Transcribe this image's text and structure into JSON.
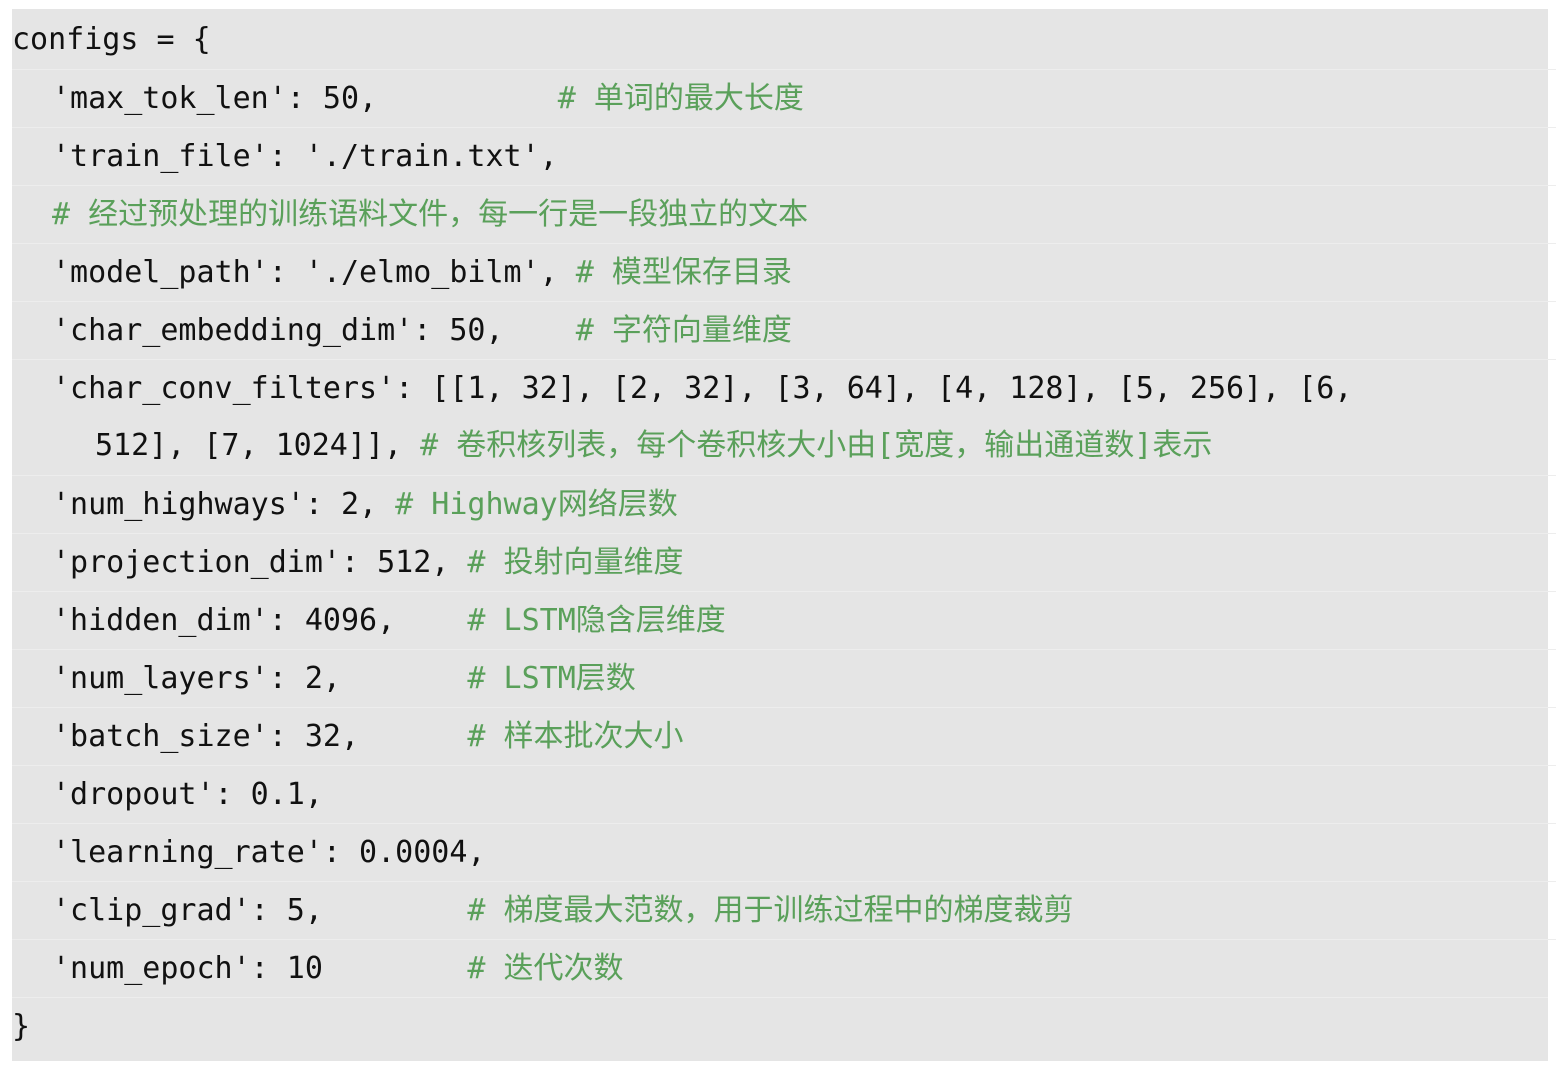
{
  "lines": [
    {
      "code": "configs = {",
      "comment": ""
    },
    {
      "code": "'max_tok_len': 50,          ",
      "comment": "# 单词的最大长度"
    },
    {
      "code": "'train_file': './train.txt',",
      "comment": ""
    },
    {
      "code": "",
      "comment": "# 经过预处理的训练语料文件，每一行是一段独立的文本"
    },
    {
      "code": "'model_path': './elmo_bilm', ",
      "comment": "# 模型保存目录"
    },
    {
      "code": "'char_embedding_dim': 50,    ",
      "comment": "# 字符向量维度"
    },
    {
      "code": "'char_conv_filters': [[1, 32], [2, 32], [3, 64], [4, 128], [5, 256], [6,",
      "comment": ""
    },
    {
      "code": "512], [7, 1024]], ",
      "comment": "# 卷积核列表，每个卷积核大小由[宽度，输出通道数]表示"
    },
    {
      "code": "'num_highways': 2, ",
      "comment": "# Highway网络层数"
    },
    {
      "code": "'projection_dim': 512, ",
      "comment": "# 投射向量维度"
    },
    {
      "code": "'hidden_dim': 4096,    ",
      "comment": "# LSTM隐含层维度"
    },
    {
      "code": "'num_layers': 2,       ",
      "comment": "# LSTM层数"
    },
    {
      "code": "'batch_size': 32,      ",
      "comment": "# 样本批次大小"
    },
    {
      "code": "'dropout': 0.1,",
      "comment": ""
    },
    {
      "code": "'learning_rate': 0.0004,",
      "comment": ""
    },
    {
      "code": "'clip_grad': 5,        ",
      "comment": "# 梯度最大范数，用于训练过程中的梯度裁剪"
    },
    {
      "code": "'num_epoch': 10        ",
      "comment": "# 迭代次数"
    },
    {
      "code": "}",
      "comment": ""
    }
  ],
  "colors": {
    "background": "#e5e5e5",
    "code_text": "#111111",
    "comment_text": "#5aa05a"
  }
}
